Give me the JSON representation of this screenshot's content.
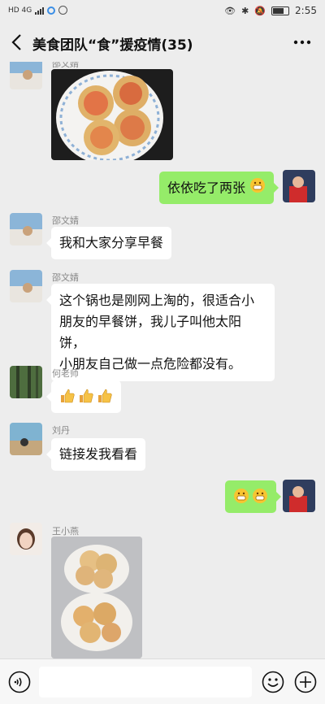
{
  "status_bar": {
    "left_text": "HD 4G",
    "time": "2:55"
  },
  "header": {
    "title": "美食团队“食”援疫情(35)"
  },
  "messages": [
    {
      "sender": "邵文婧",
      "type": "image"
    },
    {
      "sender": "me",
      "text": "依依吃了两张"
    },
    {
      "sender": "邵文婧",
      "text": "我和大家分享早餐"
    },
    {
      "sender": "邵文婧",
      "lines": [
        "这个锅也是刚网上淘的，很适合小",
        "朋友的早餐饼，我儿子叫他太阳饼，",
        "小朋友自己做一点危险都没有。"
      ]
    },
    {
      "sender": "何老师",
      "type": "emoji",
      "emoji_names": [
        "thumbs-up-icon",
        "thumbs-up-icon",
        "thumbs-up-icon"
      ]
    },
    {
      "sender": "刘丹",
      "text": "链接发我看看"
    },
    {
      "sender": "me",
      "type": "emoji",
      "emoji_names": [
        "grin-emoji-icon",
        "grin-emoji-icon"
      ]
    },
    {
      "sender": "王小燕",
      "type": "image"
    }
  ],
  "colors": {
    "my_bubble": "#95ec69",
    "background": "#ededed"
  }
}
